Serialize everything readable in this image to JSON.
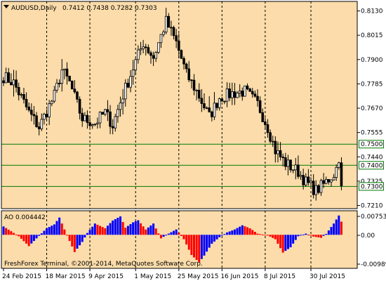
{
  "colors": {
    "background": "#ffffff",
    "plot_background": "#fbdcaa",
    "candle": "#000000",
    "level_line": "#007a00",
    "ao_up": "#0000ff",
    "ao_down": "#ff0000",
    "grid": "#000000"
  },
  "main": {
    "symbol_label": "AUDUSD,Daily",
    "ohlc_label": "0.7412 0.7438 0.7282 0.7303",
    "collapse_icon": "triangle-down-icon",
    "price_ticks": [
      "0.8130",
      "0.8015",
      "0.7900",
      "0.7785",
      "0.7670",
      "0.7555",
      "0.7440",
      "0.7325",
      "0.7210"
    ],
    "level_tags": [
      "0.7500",
      "0.7400",
      "0.7300"
    ]
  },
  "ao": {
    "label": "AO 0.004442",
    "ticks": [
      "0.00753",
      "0.00",
      "-0.00989"
    ],
    "watermark": "FreshForex Terminal, ©2001-2014, MetaQuotes Software Corp."
  },
  "dates": [
    "24 Feb 2015",
    "18 Mar 2015",
    "9 Apr 2015",
    "1 May 2015",
    "25 May 2015",
    "16 Jun 2015",
    "8 Jul 2015",
    "30 Jul 2015"
  ],
  "chart_data": [
    {
      "type": "candlestick",
      "title": "AUDUSD,Daily",
      "ylim": [
        0.7195,
        0.8175
      ],
      "yticks": [
        0.813,
        0.8015,
        0.79,
        0.7785,
        0.767,
        0.7555,
        0.744,
        0.7325,
        0.721
      ],
      "levels": [
        0.75,
        0.74,
        0.73
      ],
      "x_tick_labels": [
        "24 Feb 2015",
        "18 Mar 2015",
        "9 Apr 2015",
        "1 May 2015",
        "25 May 2015",
        "16 Jun 2015",
        "8 Jul 2015",
        "30 Jul 2015"
      ],
      "last_bar": {
        "open": 0.7412,
        "high": 0.7438,
        "low": 0.7282,
        "close": 0.7303
      },
      "close_path": [
        {
          "bar": 0,
          "close": 0.782
        },
        {
          "bar": 4,
          "close": 0.779
        },
        {
          "bar": 10,
          "close": 0.765
        },
        {
          "bar": 14,
          "close": 0.758
        },
        {
          "bar": 20,
          "close": 0.773
        },
        {
          "bar": 23,
          "close": 0.785
        },
        {
          "bar": 26,
          "close": 0.779
        },
        {
          "bar": 31,
          "close": 0.762
        },
        {
          "bar": 36,
          "close": 0.76
        },
        {
          "bar": 40,
          "close": 0.765
        },
        {
          "bar": 43,
          "close": 0.759
        },
        {
          "bar": 46,
          "close": 0.77
        },
        {
          "bar": 51,
          "close": 0.786
        },
        {
          "bar": 55,
          "close": 0.798
        },
        {
          "bar": 59,
          "close": 0.791
        },
        {
          "bar": 64,
          "close": 0.808
        },
        {
          "bar": 68,
          "close": 0.798
        },
        {
          "bar": 72,
          "close": 0.783
        },
        {
          "bar": 76,
          "close": 0.775
        },
        {
          "bar": 81,
          "close": 0.763
        },
        {
          "bar": 85,
          "close": 0.772
        },
        {
          "bar": 90,
          "close": 0.774
        },
        {
          "bar": 95,
          "close": 0.775
        },
        {
          "bar": 100,
          "close": 0.769
        },
        {
          "bar": 104,
          "close": 0.758
        },
        {
          "bar": 107,
          "close": 0.747
        },
        {
          "bar": 111,
          "close": 0.741
        },
        {
          "bar": 116,
          "close": 0.737
        },
        {
          "bar": 119,
          "close": 0.732
        },
        {
          "bar": 123,
          "close": 0.728
        },
        {
          "bar": 126,
          "close": 0.731
        },
        {
          "bar": 130,
          "close": 0.736
        },
        {
          "bar": 132,
          "close": 0.7412
        },
        {
          "bar": 133,
          "close": 0.7303
        }
      ]
    },
    {
      "type": "bar",
      "title": "AO 0.004442",
      "ylim": [
        -0.0113,
        0.0081
      ],
      "yticks": [
        0.00753,
        0.0,
        -0.00989
      ],
      "last_value": 0.004442,
      "value_path": [
        {
          "bar": 0,
          "value": 0.0028
        },
        {
          "bar": 3,
          "value": 0.0012
        },
        {
          "bar": 6,
          "value": -0.0005
        },
        {
          "bar": 10,
          "value": -0.0038
        },
        {
          "bar": 13,
          "value": -0.0012
        },
        {
          "bar": 17,
          "value": 0.0022
        },
        {
          "bar": 20,
          "value": 0.0035
        },
        {
          "bar": 22,
          "value": 0.0058
        },
        {
          "bar": 25,
          "value": -0.0002
        },
        {
          "bar": 28,
          "value": -0.0058
        },
        {
          "bar": 31,
          "value": -0.0024
        },
        {
          "bar": 33,
          "value": 0.0006
        },
        {
          "bar": 36,
          "value": 0.0038
        },
        {
          "bar": 40,
          "value": 0.0022
        },
        {
          "bar": 43,
          "value": 0.0048
        },
        {
          "bar": 46,
          "value": 0.0062
        },
        {
          "bar": 48,
          "value": 0.0024
        },
        {
          "bar": 51,
          "value": 0.0042
        },
        {
          "bar": 53,
          "value": 0.0049
        },
        {
          "bar": 56,
          "value": 0.0018
        },
        {
          "bar": 59,
          "value": 0.0038
        },
        {
          "bar": 62,
          "value": -0.0012
        },
        {
          "bar": 65,
          "value": 0.0004
        },
        {
          "bar": 68,
          "value": 0.0018
        },
        {
          "bar": 71,
          "value": -0.0015
        },
        {
          "bar": 74,
          "value": -0.0068
        },
        {
          "bar": 77,
          "value": -0.0093
        },
        {
          "bar": 79,
          "value": -0.007
        },
        {
          "bar": 82,
          "value": -0.003
        },
        {
          "bar": 85,
          "value": -0.0008
        },
        {
          "bar": 88,
          "value": 0.0008
        },
        {
          "bar": 91,
          "value": 0.0018
        },
        {
          "bar": 94,
          "value": 0.0032
        },
        {
          "bar": 97,
          "value": 0.0022
        },
        {
          "bar": 100,
          "value": 0.0004
        },
        {
          "bar": 104,
          "value": -0.0002
        },
        {
          "bar": 107,
          "value": -0.0015
        },
        {
          "bar": 110,
          "value": -0.006
        },
        {
          "bar": 113,
          "value": -0.0042
        },
        {
          "bar": 116,
          "value": -0.0005
        },
        {
          "bar": 119,
          "value": 0.0004
        },
        {
          "bar": 122,
          "value": -0.0006
        },
        {
          "bar": 125,
          "value": -0.001
        },
        {
          "bar": 127,
          "value": 0.0003
        },
        {
          "bar": 130,
          "value": 0.0038
        },
        {
          "bar": 132,
          "value": 0.0065
        },
        {
          "bar": 133,
          "value": 0.004442
        }
      ]
    }
  ]
}
